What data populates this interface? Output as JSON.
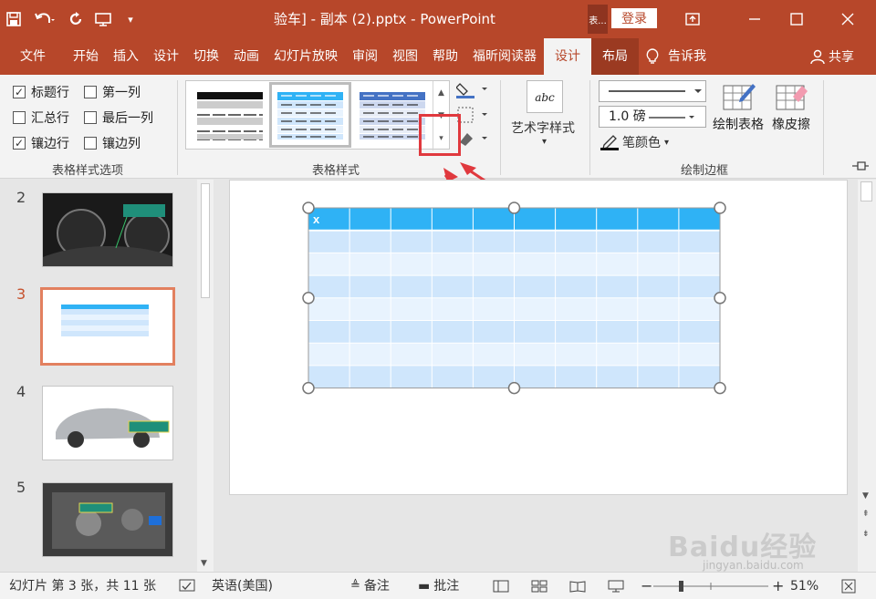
{
  "window": {
    "title": "验车] - 副本 (2).pptx  -  PowerPoint",
    "context_tag": "表...",
    "login": "登录"
  },
  "tabs": [
    "文件",
    "开始",
    "插入",
    "设计",
    "切换",
    "动画",
    "幻灯片放映",
    "审阅",
    "视图",
    "帮助",
    "福昕阅读器"
  ],
  "context_tabs": {
    "design": "设计",
    "layout": "布局"
  },
  "tell_me": "告诉我",
  "share": "共享",
  "style_options": {
    "header_row": "标题行",
    "first_column": "第一列",
    "total_row": "汇总行",
    "last_column": "最后一列",
    "banded_rows": "镶边行",
    "banded_columns": "镶边列",
    "group_label": "表格样式选项"
  },
  "table_styles": {
    "group_label": "表格样式"
  },
  "wordart": {
    "label": "艺术字样式",
    "icon_text": "abc"
  },
  "borders": {
    "weight": "1.0 磅",
    "pen_color": "笔颜色",
    "draw_table": "绘制表格",
    "eraser": "橡皮擦",
    "group_label": "绘制边框"
  },
  "slides": [
    {
      "number": "2"
    },
    {
      "number": "3"
    },
    {
      "number": "4"
    },
    {
      "number": "5"
    }
  ],
  "slide_table": {
    "header_cell": "x",
    "columns": 10,
    "rows": 7
  },
  "status": {
    "slide_info": "幻灯片 第 3 张，共 11 张",
    "language": "英语(美国)",
    "notes": "备注",
    "comments": "批注",
    "zoom_minus": "−",
    "zoom_plus": "+",
    "zoom": "51%"
  },
  "watermark": {
    "main": "Baidu经验",
    "sub": "jingyan.baidu.com"
  },
  "colors": {
    "accent": "#b7472a",
    "table_header": "#2fb2f5",
    "band_a": "#cfe6fc",
    "band_b": "#e8f3fe",
    "highlight": "#e0393e"
  }
}
